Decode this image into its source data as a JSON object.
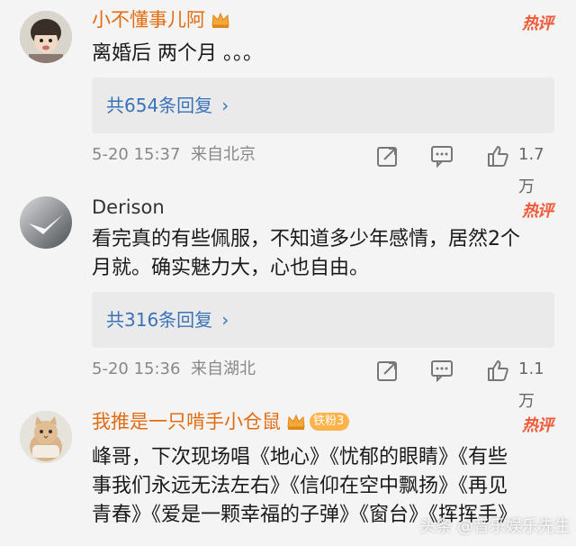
{
  "comments": [
    {
      "username": "小不懂事儿阿",
      "hot_label": "热评",
      "text_lines": [
        "离婚后 两个月 。。。"
      ],
      "reply_label": "共654条回复",
      "time": "5-20 15:37",
      "location": "来自北京",
      "likes": "1.7万"
    },
    {
      "username": "Derison",
      "hot_label": "热评",
      "text_lines": [
        "看完真的有些佩服，不知道多少年感情，居然2个",
        "月就。确实魅力大，心也自由。"
      ],
      "reply_label": "共316条回复",
      "time": "5-20 15:36",
      "location": "来自湖北",
      "likes": "1.1万"
    },
    {
      "username": "我推是一只啃手小仓鼠",
      "fan_badge": "铁粉3",
      "hot_label": "热评",
      "text_lines": [
        "峰哥，下次现场唱《地心》《忧郁的眼睛》《有些",
        "事我们永远无法左右》《信仰在空中飘扬》《再见",
        "青春》《爱是一颗幸福的子弹》《窗台》《挥挥手》"
      ]
    }
  ],
  "icons": {
    "crown": "vip-crown-icon",
    "share": "share-icon",
    "comment": "comment-icon",
    "like": "like-icon",
    "chevron": "chevron-right-icon"
  },
  "colors": {
    "vip_name": "#e36b10",
    "hot": "#f05a3a",
    "link": "#3a72b8",
    "meta": "#888888",
    "reply_bg": "#eaeaea",
    "page_bg": "#f4f4f4"
  },
  "watermark": "头条 @音乐娱乐先生"
}
